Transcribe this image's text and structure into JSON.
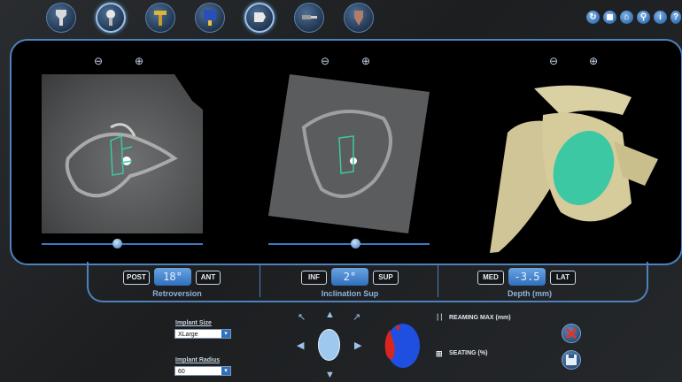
{
  "toolbar": {
    "tools": [
      {
        "name": "scapula-tool-icon",
        "active": false
      },
      {
        "name": "implant-position-tool-icon",
        "active": true
      },
      {
        "name": "reamer-tool-icon",
        "active": false
      },
      {
        "name": "implant-card-tool-icon",
        "active": false
      },
      {
        "name": "glenoid-view-tool-icon",
        "active": true
      },
      {
        "name": "drill-tool-icon",
        "active": false
      },
      {
        "name": "shoulder-model-tool-icon",
        "active": false
      }
    ],
    "window_controls": [
      {
        "name": "refresh-icon",
        "glyph": "↻"
      },
      {
        "name": "camera-icon",
        "glyph": "◼"
      },
      {
        "name": "home-icon",
        "glyph": "⌂"
      },
      {
        "name": "search-icon",
        "glyph": "⚲"
      },
      {
        "name": "info-icon",
        "glyph": "i"
      },
      {
        "name": "help-icon",
        "glyph": "?"
      }
    ]
  },
  "views": {
    "zoom_out_glyph": "⊖",
    "zoom_in_glyph": "⊕",
    "axial_slider": 0.47,
    "coronal_slider": 0.54
  },
  "controls": {
    "retroversion": {
      "minus": "POST",
      "value": "18°",
      "plus": "ANT",
      "label": "Retroversion"
    },
    "inclination": {
      "minus": "INF",
      "value": "2°",
      "plus": "SUP",
      "label": "Inclination Sup"
    },
    "depth": {
      "minus": "MED",
      "value": "-3.5",
      "plus": "LAT",
      "label": "Depth (mm)"
    }
  },
  "implant": {
    "size_label": "Implant Size",
    "size_value": "XLarge",
    "radius_label": "Implant Radius",
    "radius_value": "60"
  },
  "legend": {
    "reaming": "REAMING MAX (mm)",
    "seating": "SEATING (%)"
  },
  "colors": {
    "accent": "#4d82bd",
    "implant": "#3cc8a3",
    "seating_blue": "#1f4fe0",
    "seating_red": "#d8261e"
  }
}
